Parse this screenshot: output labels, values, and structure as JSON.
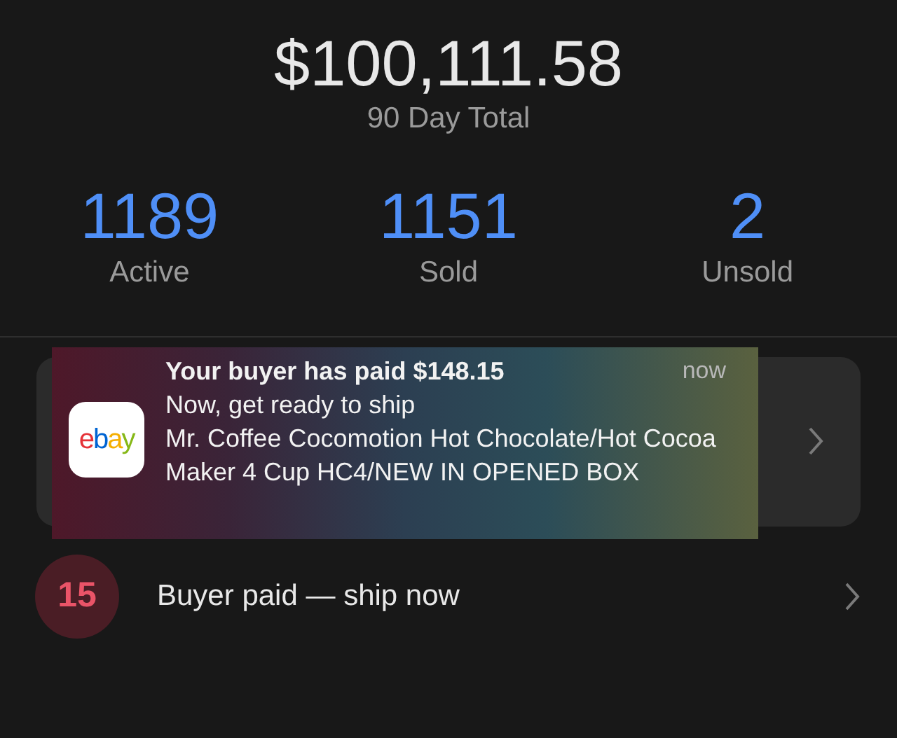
{
  "summary": {
    "total": "$100,111.58",
    "caption": "90 Day Total"
  },
  "stats": [
    {
      "value": "1189",
      "label": "Active"
    },
    {
      "value": "1151",
      "label": "Sold"
    },
    {
      "value": "2",
      "label": "Unsold"
    }
  ],
  "notification": {
    "app_logo": "ebay",
    "title": "Your buyer has paid $148.15",
    "time": "now",
    "subtitle": "Now, get ready to ship",
    "body": "Mr. Coffee Cocomotion Hot Chocolate/Hot Cocoa Maker 4 Cup HC4/NEW IN OPENED BOX"
  },
  "tasks": [
    {
      "count": "15",
      "label": "Buyer paid — ship now"
    }
  ]
}
